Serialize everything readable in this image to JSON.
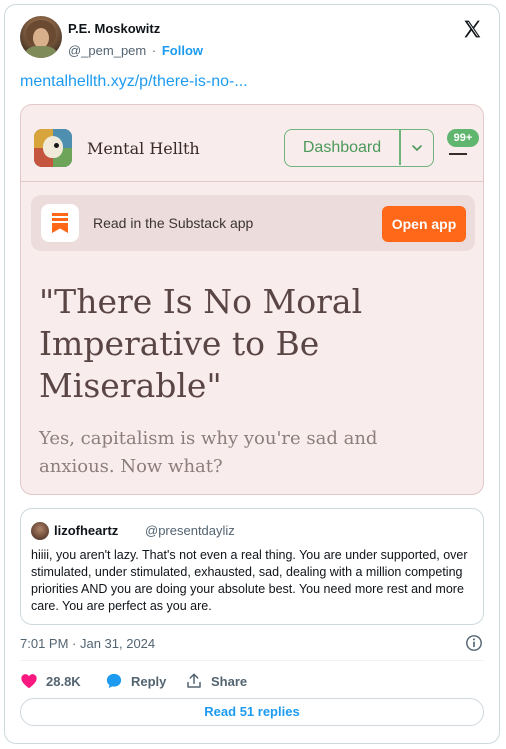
{
  "tweet": {
    "author_name": "P.E. Moskowitz",
    "author_handle": "@_pem_pem",
    "separator": "·",
    "follow_label": "Follow",
    "link_text": "mentalhellth.xyz/p/there-is-no-...",
    "timestamp": "7:01 PM · Jan 31, 2024"
  },
  "preview": {
    "publication_name": "Mental Hellth",
    "dashboard_label": "Dashboard",
    "notification_badge": "99+",
    "app_banner_text": "Read in the Substack app",
    "open_app_label": "Open app",
    "post_title": "\"There Is No Moral Imperative to Be Miserable\"",
    "post_subtitle": "Yes, capitalism is why you're sad and anxious. Now what?",
    "colors": {
      "accent_green": "#6fb47a",
      "substack_orange": "#ff6719",
      "background": "#f9ecec"
    }
  },
  "quote": {
    "author_name": "lizofheartz",
    "author_handle": "@presentdayliz",
    "text": "hiiii, you aren't lazy. That's not even a real thing. You are under supported, over stimulated, under stimulated, exhausted, sad, dealing with a million competing priorities AND you are doing your absolute best. You need more rest and more care. You are perfect as you are."
  },
  "actions": {
    "like_count": "28.8K",
    "reply_label": "Reply",
    "share_label": "Share",
    "read_replies_label": "Read 51 replies"
  },
  "icons": {
    "x_logo": "x-logo-icon",
    "like": "heart-icon",
    "reply": "chat-bubble-icon",
    "share": "share-upload-icon",
    "info": "info-icon",
    "chevron": "chevron-down-icon",
    "menu": "menu-icon"
  },
  "colors": {
    "link_blue": "#1d9bf0",
    "like_pink": "#f91880",
    "muted_gray": "#536471"
  }
}
